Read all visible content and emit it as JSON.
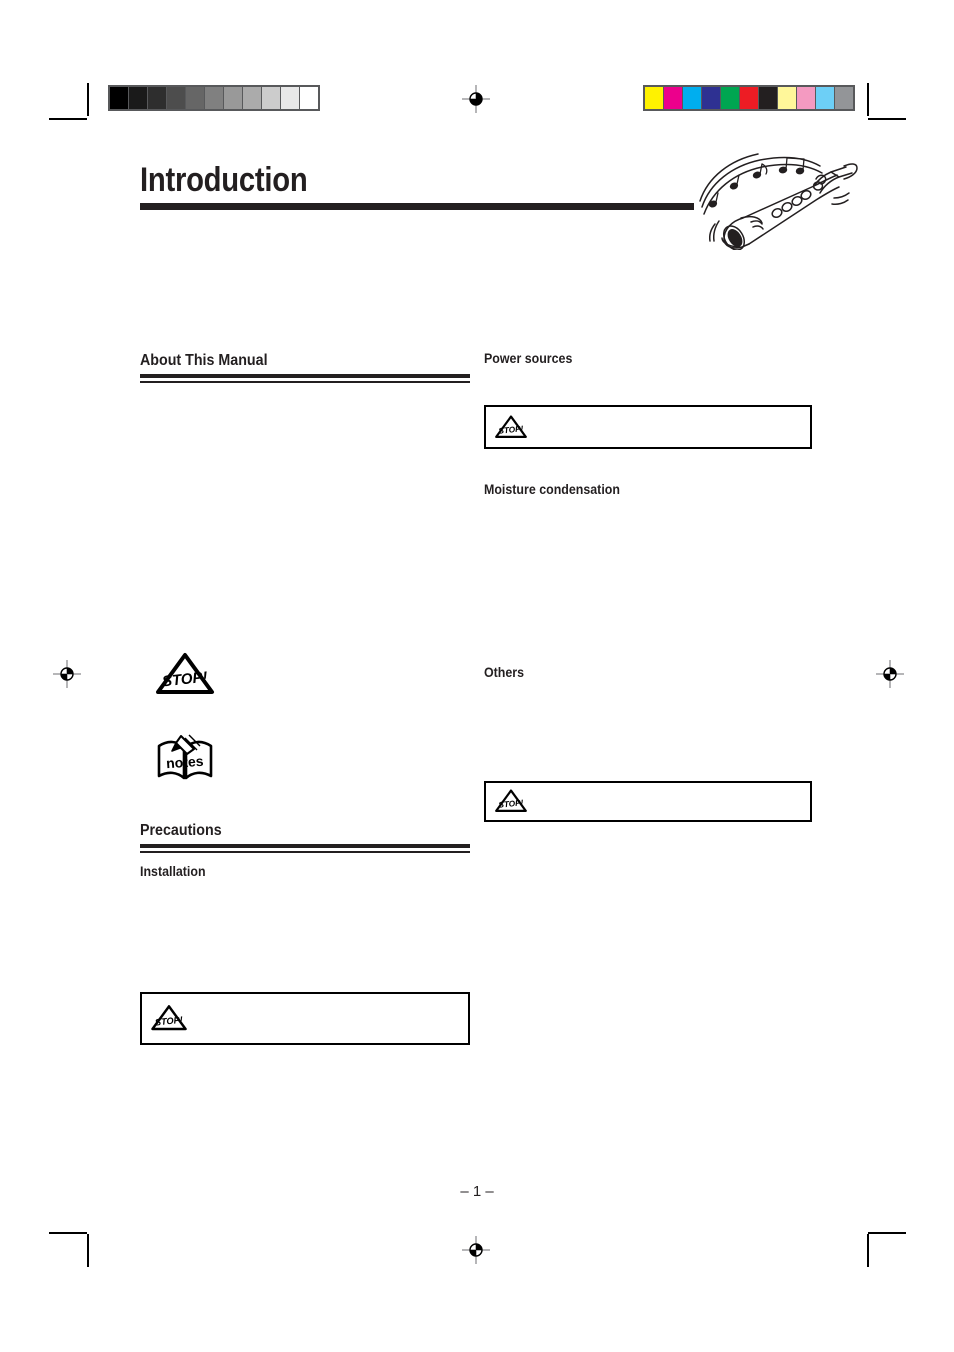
{
  "document": {
    "page_title": "Introduction",
    "page_number": "– 1 –"
  },
  "calibration": {
    "gray_bar": {
      "name": "grayscale-calibration-bar",
      "swatches": [
        "#000000",
        "#1a1a1a",
        "#2e2e2e",
        "#4d4d4d",
        "#666666",
        "#808080",
        "#999999",
        "#ababab",
        "#cccccc",
        "#e8e8e8",
        "#ffffff"
      ]
    },
    "color_bar": {
      "name": "color-calibration-bar",
      "swatches": [
        "#fff200",
        "#ec008c",
        "#00aeef",
        "#2e3192",
        "#00a651",
        "#ed1c24",
        "#231f20",
        "#fff79a",
        "#f49ac1",
        "#6dcff6",
        "#939598"
      ]
    }
  },
  "illustration": {
    "name": "saxophone-with-music-notes"
  },
  "left_column": {
    "sections": [
      {
        "id": "about-this-manual",
        "heading": "About This Manual",
        "rule": true
      },
      {
        "id": "precautions",
        "heading": "Precautions",
        "rule": true
      }
    ],
    "sub_heading": "Installation",
    "icons": [
      {
        "id": "stop-legend",
        "type": "stop",
        "label": "STOP!"
      },
      {
        "id": "notes-legend",
        "type": "notes",
        "label": "notes"
      }
    ],
    "notice_box": {
      "id": "installation-caution",
      "icon": "stop",
      "icon_label": "STOP!",
      "text": ""
    }
  },
  "right_column": {
    "sections": [
      {
        "id": "power-sources",
        "heading": "Power sources"
      },
      {
        "id": "moisture-condensation",
        "heading": "Moisture condensation"
      },
      {
        "id": "others",
        "heading": "Others"
      }
    ],
    "notice_boxes": [
      {
        "id": "power-sources-caution",
        "icon": "stop",
        "icon_label": "STOP!",
        "text": ""
      },
      {
        "id": "others-caution",
        "icon": "stop",
        "icon_label": "STOP!",
        "text": ""
      }
    ]
  },
  "printer_marks": {
    "registration_targets": 4,
    "crop_marks": 8,
    "mark_color": "#000000"
  },
  "colors": {
    "ink": "#231f20",
    "paper": "#ffffff",
    "rule": "#231f20"
  }
}
